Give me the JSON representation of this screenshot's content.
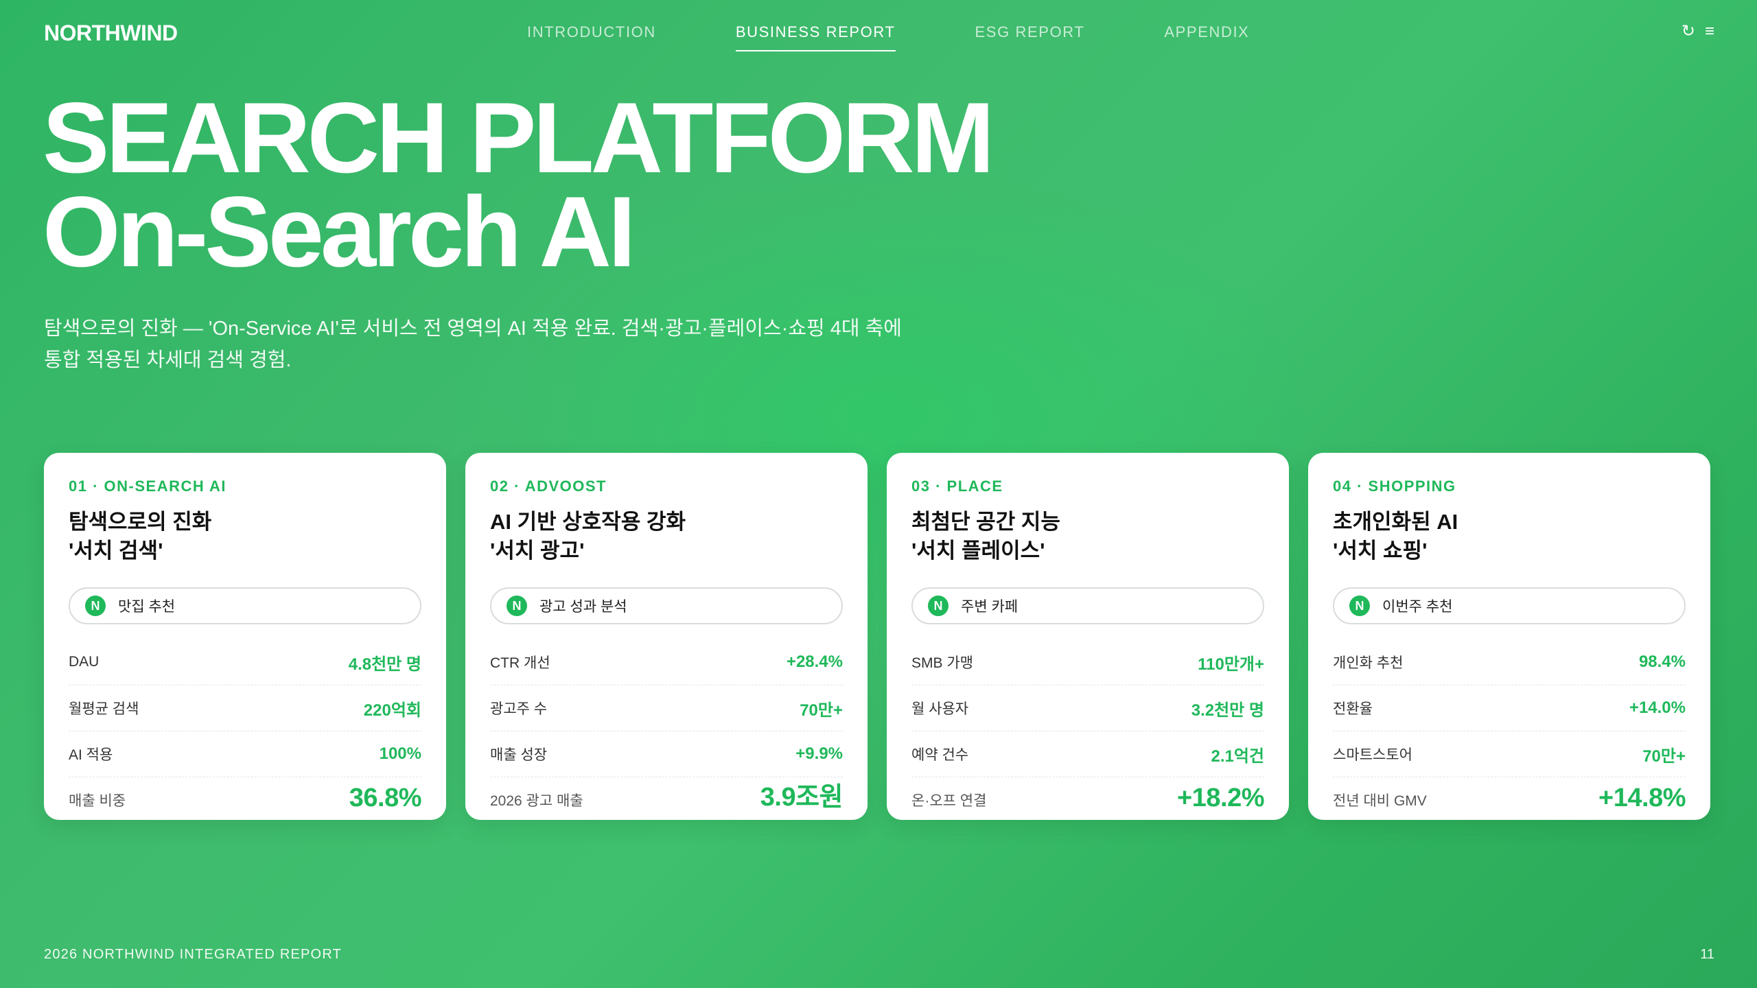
{
  "header": {
    "logo": "NORTHWIND",
    "nav": [
      {
        "label": "INTRODUCTION",
        "active": false
      },
      {
        "label": "BUSINESS REPORT",
        "active": true
      },
      {
        "label": "ESG REPORT",
        "active": false
      },
      {
        "label": "APPENDIX",
        "active": false
      }
    ],
    "icons": {
      "refresh": {
        "name": "refresh-icon",
        "glyph": "↻"
      },
      "menu": {
        "name": "menu-icon",
        "glyph": "≡"
      }
    }
  },
  "hero": {
    "title_line1": "SEARCH PLATFORM",
    "title_line2": "On-Search AI",
    "description_line1": "탐색으로의 진화 — 'On-Service AI'로 서비스 전 영역의 AI 적용 완료. 검색·광고·플레이스·쇼핑 4대 축에",
    "description_line2": "통합 적용된 차세대 검색 경험."
  },
  "colors": {
    "accent": "#1fb85a",
    "background": "#3ebb6c"
  },
  "cards": [
    {
      "tag": "01 · ON-SEARCH AI",
      "title": "탐색으로의 진화\n'서치 검색'",
      "badge": "N",
      "search": "맛집 추천",
      "metrics": [
        {
          "label": "DAU",
          "value": "4.8천만 명"
        },
        {
          "label": "월평균 검색",
          "value": "220억회"
        },
        {
          "label": "AI 적용",
          "value": "100%"
        }
      ],
      "footer_label": "매출 비중",
      "footer_value": "36.8%"
    },
    {
      "tag": "02 · ADVOOST",
      "title": "AI 기반 상호작용 강화\n'서치 광고'",
      "badge": "N",
      "search": "광고 성과 분석",
      "metrics": [
        {
          "label": "CTR 개선",
          "value": "+28.4%"
        },
        {
          "label": "광고주 수",
          "value": "70만+"
        },
        {
          "label": "매출 성장",
          "value": "+9.9%"
        }
      ],
      "footer_label": "2026 광고 매출",
      "footer_value": "3.9조원"
    },
    {
      "tag": "03 · PLACE",
      "title": "최첨단 공간 지능\n'서치 플레이스'",
      "badge": "N",
      "search": "주변 카페",
      "metrics": [
        {
          "label": "SMB 가맹",
          "value": "110만개+"
        },
        {
          "label": "월 사용자",
          "value": "3.2천만 명"
        },
        {
          "label": "예약 건수",
          "value": "2.1억건"
        }
      ],
      "footer_label": "온·오프 연결",
      "footer_value": "+18.2%"
    },
    {
      "tag": "04 · SHOPPING",
      "title": "초개인화된 AI\n'서치 쇼핑'",
      "badge": "N",
      "search": "이번주 추천",
      "metrics": [
        {
          "label": "개인화 추천",
          "value": "98.4%"
        },
        {
          "label": "전환율",
          "value": "+14.0%"
        },
        {
          "label": "스마트스토어",
          "value": "70만+"
        }
      ],
      "footer_label": "전년 대비 GMV",
      "footer_value": "+14.8%"
    }
  ],
  "footer": {
    "report_name": "2026 NORTHWIND INTEGRATED REPORT",
    "page_number": "11"
  }
}
